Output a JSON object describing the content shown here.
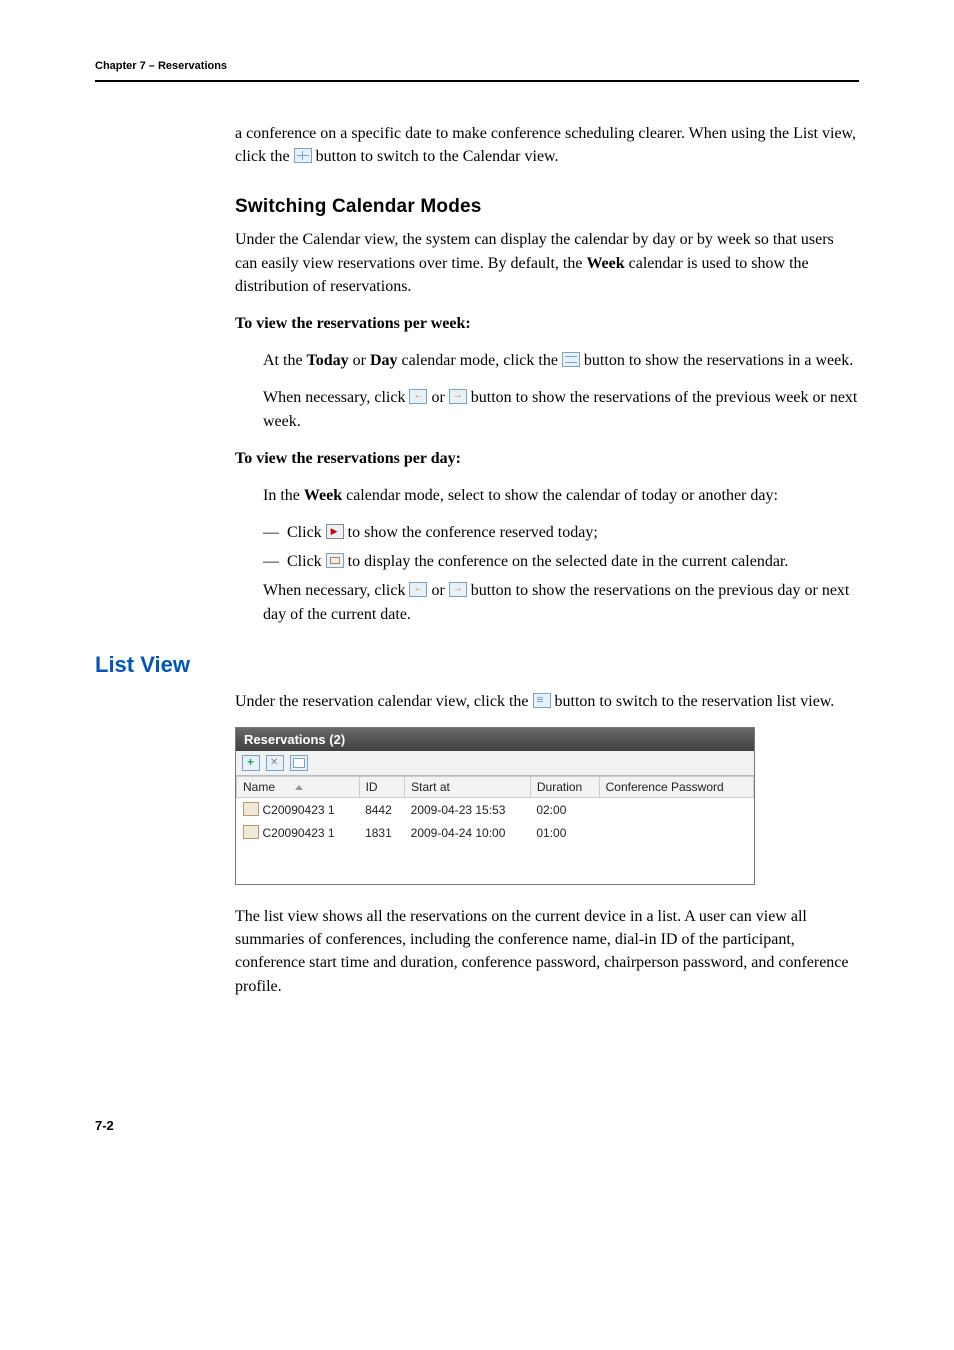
{
  "header": {
    "chapter": "Chapter 7 – Reservations"
  },
  "intro": {
    "p1a": "a conference on a specific date to make conference scheduling clearer. When using the List view, click the ",
    "p1b": " button to switch to the Calendar view."
  },
  "s1": {
    "title": "Switching Calendar Modes",
    "p1a": "Under the Calendar view, the system can display the calendar by day or by week so that users can easily view reservations over time. By default, the ",
    "p1b": "Week",
    "p1c": " calendar is used to show the distribution of reservations.",
    "h_week": "To view the reservations per week:",
    "week_p1a": "At the ",
    "week_p1b": "Today",
    "week_p1c": " or ",
    "week_p1d": "Day",
    "week_p1e": " calendar mode, click the ",
    "week_p1f": " button to show the reservations in a week.",
    "week_p2a": "When necessary, click ",
    "week_p2b": " or ",
    "week_p2c": " button to show the reservations of the previous week or next week.",
    "h_day": "To view the reservations per day:",
    "day_p1a": "In the ",
    "day_p1b": "Week",
    "day_p1c": " calendar mode, select to show the calendar of today or another day:",
    "day_d1a": "Click ",
    "day_d1b": " to show the conference reserved today;",
    "day_d2a": "Click ",
    "day_d2b": " to display the conference on the selected date in the current calendar.",
    "day_p2a": "When necessary, click ",
    "day_p2b": " or ",
    "day_p2c": " button to show the reservations on the previous day or next day of the current date."
  },
  "s2": {
    "title": "List View",
    "p1a": "Under the reservation calendar view, click the ",
    "p1b": " button to switch to the reservation list view.",
    "p2": "The list view shows all the reservations on the current device in a list. A user can view all summaries of conferences, including the conference name, dial-in ID of the participant, conference start time and duration, conference password, chairperson password, and conference profile."
  },
  "panel": {
    "title": "Reservations (2)",
    "cols": {
      "name": "Name",
      "id": "ID",
      "start": "Start at",
      "duration": "Duration",
      "confpw": "Conference Password"
    },
    "rows": [
      {
        "name": "C20090423 1",
        "id": "8442",
        "start": "2009-04-23 15:53",
        "duration": "02:00",
        "confpw": ""
      },
      {
        "name": "C20090423 1",
        "id": "1831",
        "start": "2009-04-24 10:00",
        "duration": "01:00",
        "confpw": ""
      }
    ]
  },
  "footer": {
    "page": "7-2"
  }
}
